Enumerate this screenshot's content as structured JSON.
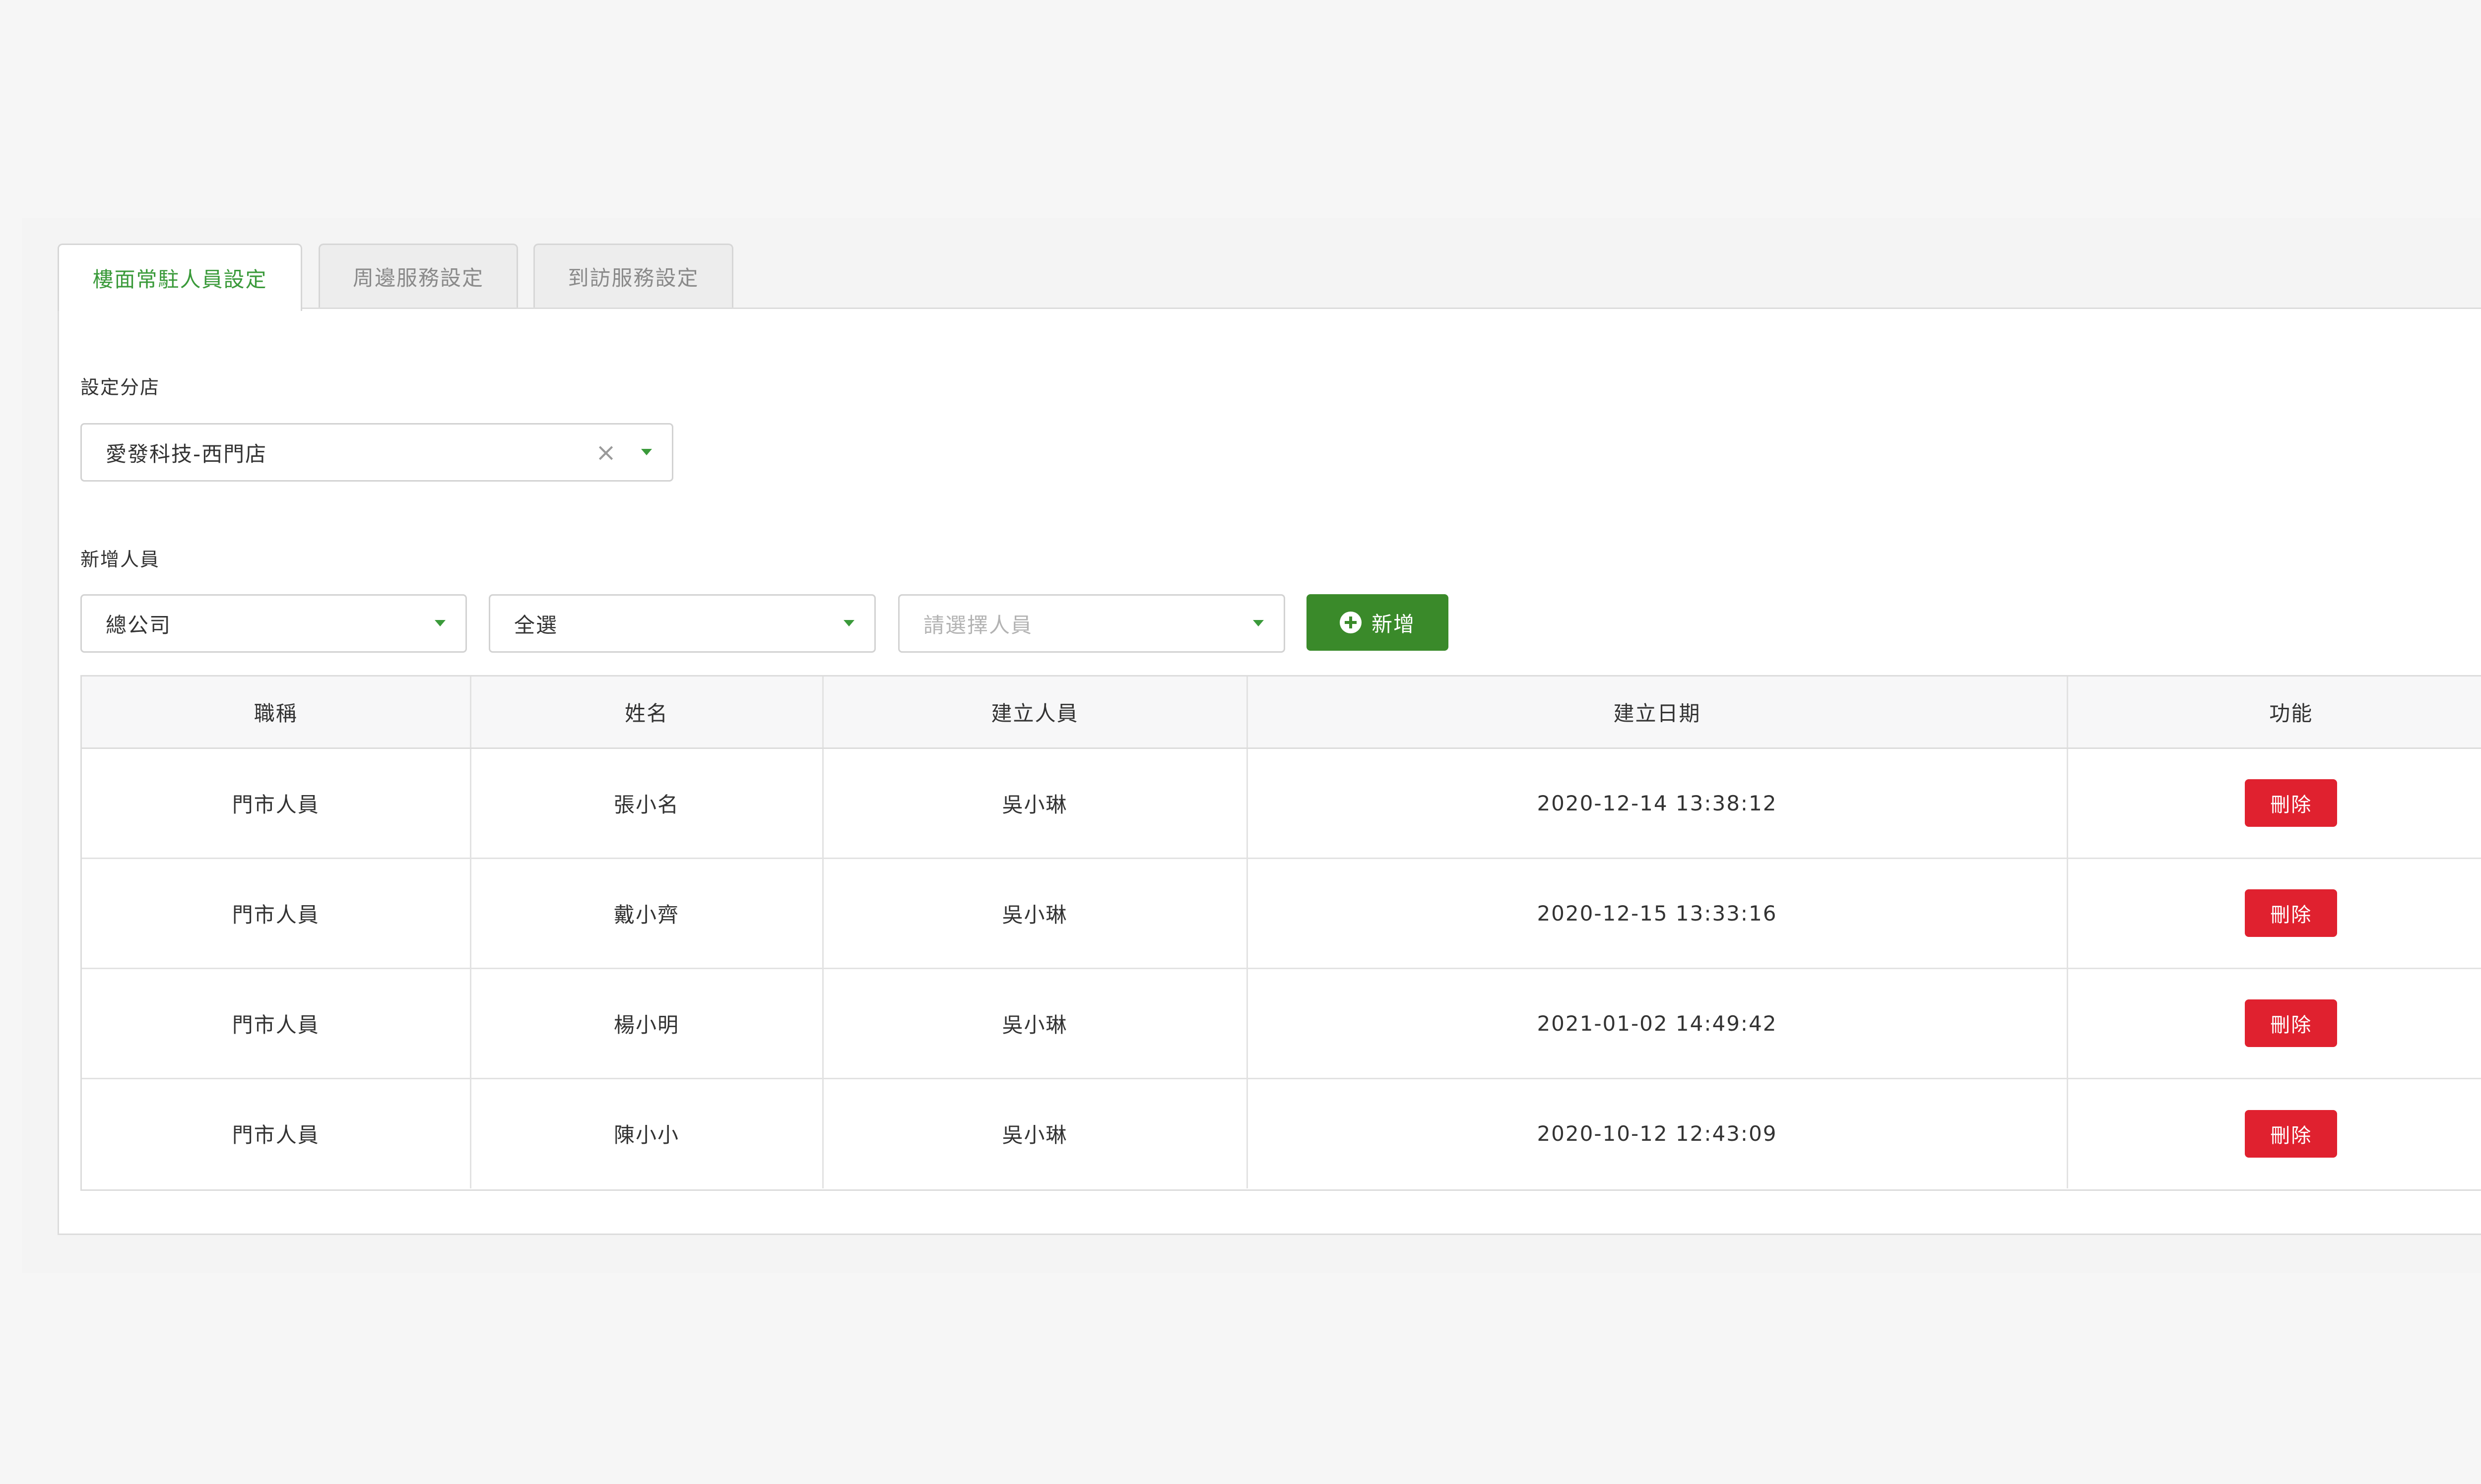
{
  "tabs": [
    {
      "label": "樓面常駐人員設定",
      "active": true
    },
    {
      "label": "周邊服務設定",
      "active": false
    },
    {
      "label": "到訪服務設定",
      "active": false
    }
  ],
  "branch": {
    "label": "設定分店",
    "value": "愛發科技-西門店"
  },
  "add_staff": {
    "label": "新增人員",
    "company_select": "總公司",
    "role_select": "全選",
    "person_placeholder": "請選擇人員",
    "add_button": "新增"
  },
  "table": {
    "headers": [
      "職稱",
      "姓名",
      "建立人員",
      "建立日期",
      "功能"
    ],
    "rows": [
      {
        "title": "門市人員",
        "name": "張小名",
        "creator": "吳小琳",
        "date": "2020-12-14 13:38:12",
        "action": "刪除"
      },
      {
        "title": "門市人員",
        "name": "戴小齊",
        "creator": "吳小琳",
        "date": "2020-12-15 13:33:16",
        "action": "刪除"
      },
      {
        "title": "門市人員",
        "name": "楊小明",
        "creator": "吳小琳",
        "date": "2021-01-02 14:49:42",
        "action": "刪除"
      },
      {
        "title": "門市人員",
        "name": "陳小小",
        "creator": "吳小琳",
        "date": "2020-10-12 12:43:09",
        "action": "刪除"
      }
    ]
  },
  "colors": {
    "accent_green": "#3a9a3a",
    "add_button": "#3a8a2a",
    "delete_button": "#e0212f",
    "background": "#f6f6f6"
  },
  "icons": {
    "clear": "close-icon",
    "caret": "chevron-down-icon",
    "add": "plus-circle-icon"
  }
}
